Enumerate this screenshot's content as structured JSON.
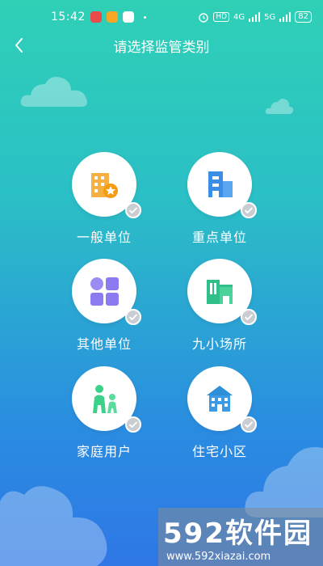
{
  "status_bar": {
    "time": "15:42",
    "network_1": "4G",
    "network_2": "5G",
    "hd": "HD",
    "battery": "82"
  },
  "nav": {
    "title": "请选择监管类别"
  },
  "categories": [
    {
      "label": "一般单位",
      "icon": "office-building-star-icon",
      "color": "#f5a623"
    },
    {
      "label": "重点单位",
      "icon": "building-icon",
      "color": "#3a8ee6"
    },
    {
      "label": "其他单位",
      "icon": "grid-apps-icon",
      "color": "#8a7cf0"
    },
    {
      "label": "九小场所",
      "icon": "shops-icon",
      "color": "#2fc08a"
    },
    {
      "label": "家庭用户",
      "icon": "family-icon",
      "color": "#3cd18a"
    },
    {
      "label": "住宅小区",
      "icon": "apartment-icon",
      "color": "#2d8fd8"
    }
  ],
  "watermark": {
    "logo": "592软件园",
    "url": "www.592xiazai.com"
  }
}
